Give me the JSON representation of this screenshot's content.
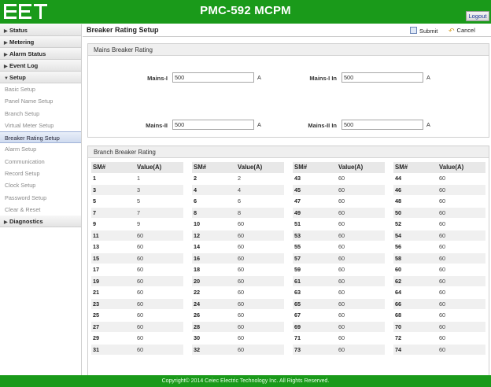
{
  "header": {
    "title": "PMC-592 MCPM",
    "logout_label": "Logout",
    "logo_icon": "company-logo",
    "brand_color": "#1a9a1a"
  },
  "sidebar": {
    "items": [
      {
        "label": "Status",
        "arrow": "▶"
      },
      {
        "label": "Metering",
        "arrow": "▶"
      },
      {
        "label": "Alarm Status",
        "arrow": "▶"
      },
      {
        "label": "Event Log",
        "arrow": "▶"
      },
      {
        "label": "Setup",
        "arrow": "▼"
      }
    ],
    "setup_items": [
      "Basic Setup",
      "Panel Name Setup",
      "Branch Setup",
      "Virtual Meter Setup",
      "Breaker Rating Setup",
      "Alarm Setup",
      "Communication",
      "Record Setup",
      "Clock Setup",
      "Password Setup",
      "Clear & Reset"
    ],
    "active_item": "Breaker Rating Setup",
    "diagnostics": {
      "label": "Diagnostics",
      "arrow": "▶"
    }
  },
  "page": {
    "title": "Breaker Rating Setup",
    "submit_label": "Submit",
    "cancel_label": "Cancel"
  },
  "mains": {
    "title": "Mains Breaker Rating",
    "fields": [
      {
        "label": "Mains-I",
        "value": "500",
        "unit": "A"
      },
      {
        "label": "Mains-I In",
        "value": "500",
        "unit": "A"
      },
      {
        "label": "Mains-II",
        "value": "500",
        "unit": "A"
      },
      {
        "label": "Mains-II In",
        "value": "500",
        "unit": "A"
      }
    ]
  },
  "branch": {
    "title": "Branch Breaker Rating",
    "col_sm": "SM#",
    "col_value": "Value(A)",
    "columns": [
      [
        [
          "1",
          "1"
        ],
        [
          "3",
          "3"
        ],
        [
          "5",
          "5"
        ],
        [
          "7",
          "7"
        ],
        [
          "9",
          "9"
        ],
        [
          "11",
          "60"
        ],
        [
          "13",
          "60"
        ],
        [
          "15",
          "60"
        ],
        [
          "17",
          "60"
        ],
        [
          "19",
          "60"
        ],
        [
          "21",
          "60"
        ],
        [
          "23",
          "60"
        ],
        [
          "25",
          "60"
        ],
        [
          "27",
          "60"
        ],
        [
          "29",
          "60"
        ],
        [
          "31",
          "60"
        ]
      ],
      [
        [
          "2",
          "2"
        ],
        [
          "4",
          "4"
        ],
        [
          "6",
          "6"
        ],
        [
          "8",
          "8"
        ],
        [
          "10",
          "60"
        ],
        [
          "12",
          "60"
        ],
        [
          "14",
          "60"
        ],
        [
          "16",
          "60"
        ],
        [
          "18",
          "60"
        ],
        [
          "20",
          "60"
        ],
        [
          "22",
          "60"
        ],
        [
          "24",
          "60"
        ],
        [
          "26",
          "60"
        ],
        [
          "28",
          "60"
        ],
        [
          "30",
          "60"
        ],
        [
          "32",
          "60"
        ]
      ],
      [
        [
          "43",
          "60"
        ],
        [
          "45",
          "60"
        ],
        [
          "47",
          "60"
        ],
        [
          "49",
          "60"
        ],
        [
          "51",
          "60"
        ],
        [
          "53",
          "60"
        ],
        [
          "55",
          "60"
        ],
        [
          "57",
          "60"
        ],
        [
          "59",
          "60"
        ],
        [
          "61",
          "60"
        ],
        [
          "63",
          "60"
        ],
        [
          "65",
          "60"
        ],
        [
          "67",
          "60"
        ],
        [
          "69",
          "60"
        ],
        [
          "71",
          "60"
        ],
        [
          "73",
          "60"
        ]
      ],
      [
        [
          "44",
          "60"
        ],
        [
          "46",
          "60"
        ],
        [
          "48",
          "60"
        ],
        [
          "50",
          "60"
        ],
        [
          "52",
          "60"
        ],
        [
          "54",
          "60"
        ],
        [
          "56",
          "60"
        ],
        [
          "58",
          "60"
        ],
        [
          "60",
          "60"
        ],
        [
          "62",
          "60"
        ],
        [
          "64",
          "60"
        ],
        [
          "66",
          "60"
        ],
        [
          "68",
          "60"
        ],
        [
          "70",
          "60"
        ],
        [
          "72",
          "60"
        ],
        [
          "74",
          "60"
        ]
      ]
    ]
  },
  "footer": {
    "text": "Copyright© 2014 Ceiec Electric Technology Inc. All Rights Reserved."
  }
}
